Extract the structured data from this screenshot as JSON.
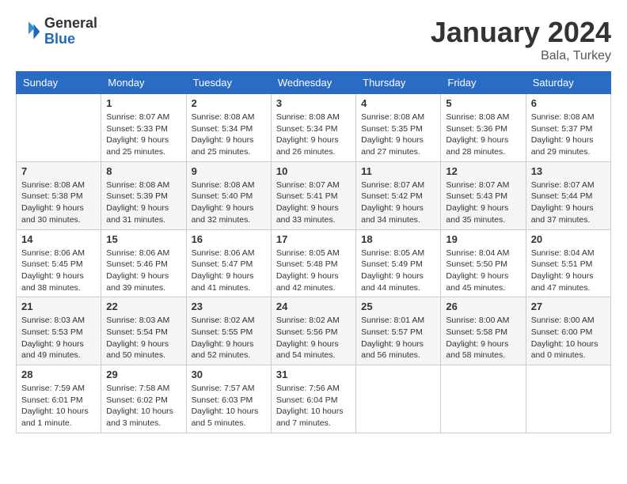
{
  "logo": {
    "general": "General",
    "blue": "Blue"
  },
  "header": {
    "title": "January 2024",
    "location": "Bala, Turkey"
  },
  "columns": [
    "Sunday",
    "Monday",
    "Tuesday",
    "Wednesday",
    "Thursday",
    "Friday",
    "Saturday"
  ],
  "weeks": [
    [
      {
        "day": "",
        "info": ""
      },
      {
        "day": "1",
        "info": "Sunrise: 8:07 AM\nSunset: 5:33 PM\nDaylight: 9 hours\nand 25 minutes."
      },
      {
        "day": "2",
        "info": "Sunrise: 8:08 AM\nSunset: 5:34 PM\nDaylight: 9 hours\nand 25 minutes."
      },
      {
        "day": "3",
        "info": "Sunrise: 8:08 AM\nSunset: 5:34 PM\nDaylight: 9 hours\nand 26 minutes."
      },
      {
        "day": "4",
        "info": "Sunrise: 8:08 AM\nSunset: 5:35 PM\nDaylight: 9 hours\nand 27 minutes."
      },
      {
        "day": "5",
        "info": "Sunrise: 8:08 AM\nSunset: 5:36 PM\nDaylight: 9 hours\nand 28 minutes."
      },
      {
        "day": "6",
        "info": "Sunrise: 8:08 AM\nSunset: 5:37 PM\nDaylight: 9 hours\nand 29 minutes."
      }
    ],
    [
      {
        "day": "7",
        "info": "Sunrise: 8:08 AM\nSunset: 5:38 PM\nDaylight: 9 hours\nand 30 minutes."
      },
      {
        "day": "8",
        "info": "Sunrise: 8:08 AM\nSunset: 5:39 PM\nDaylight: 9 hours\nand 31 minutes."
      },
      {
        "day": "9",
        "info": "Sunrise: 8:08 AM\nSunset: 5:40 PM\nDaylight: 9 hours\nand 32 minutes."
      },
      {
        "day": "10",
        "info": "Sunrise: 8:07 AM\nSunset: 5:41 PM\nDaylight: 9 hours\nand 33 minutes."
      },
      {
        "day": "11",
        "info": "Sunrise: 8:07 AM\nSunset: 5:42 PM\nDaylight: 9 hours\nand 34 minutes."
      },
      {
        "day": "12",
        "info": "Sunrise: 8:07 AM\nSunset: 5:43 PM\nDaylight: 9 hours\nand 35 minutes."
      },
      {
        "day": "13",
        "info": "Sunrise: 8:07 AM\nSunset: 5:44 PM\nDaylight: 9 hours\nand 37 minutes."
      }
    ],
    [
      {
        "day": "14",
        "info": "Sunrise: 8:06 AM\nSunset: 5:45 PM\nDaylight: 9 hours\nand 38 minutes."
      },
      {
        "day": "15",
        "info": "Sunrise: 8:06 AM\nSunset: 5:46 PM\nDaylight: 9 hours\nand 39 minutes."
      },
      {
        "day": "16",
        "info": "Sunrise: 8:06 AM\nSunset: 5:47 PM\nDaylight: 9 hours\nand 41 minutes."
      },
      {
        "day": "17",
        "info": "Sunrise: 8:05 AM\nSunset: 5:48 PM\nDaylight: 9 hours\nand 42 minutes."
      },
      {
        "day": "18",
        "info": "Sunrise: 8:05 AM\nSunset: 5:49 PM\nDaylight: 9 hours\nand 44 minutes."
      },
      {
        "day": "19",
        "info": "Sunrise: 8:04 AM\nSunset: 5:50 PM\nDaylight: 9 hours\nand 45 minutes."
      },
      {
        "day": "20",
        "info": "Sunrise: 8:04 AM\nSunset: 5:51 PM\nDaylight: 9 hours\nand 47 minutes."
      }
    ],
    [
      {
        "day": "21",
        "info": "Sunrise: 8:03 AM\nSunset: 5:53 PM\nDaylight: 9 hours\nand 49 minutes."
      },
      {
        "day": "22",
        "info": "Sunrise: 8:03 AM\nSunset: 5:54 PM\nDaylight: 9 hours\nand 50 minutes."
      },
      {
        "day": "23",
        "info": "Sunrise: 8:02 AM\nSunset: 5:55 PM\nDaylight: 9 hours\nand 52 minutes."
      },
      {
        "day": "24",
        "info": "Sunrise: 8:02 AM\nSunset: 5:56 PM\nDaylight: 9 hours\nand 54 minutes."
      },
      {
        "day": "25",
        "info": "Sunrise: 8:01 AM\nSunset: 5:57 PM\nDaylight: 9 hours\nand 56 minutes."
      },
      {
        "day": "26",
        "info": "Sunrise: 8:00 AM\nSunset: 5:58 PM\nDaylight: 9 hours\nand 58 minutes."
      },
      {
        "day": "27",
        "info": "Sunrise: 8:00 AM\nSunset: 6:00 PM\nDaylight: 10 hours\nand 0 minutes."
      }
    ],
    [
      {
        "day": "28",
        "info": "Sunrise: 7:59 AM\nSunset: 6:01 PM\nDaylight: 10 hours\nand 1 minute."
      },
      {
        "day": "29",
        "info": "Sunrise: 7:58 AM\nSunset: 6:02 PM\nDaylight: 10 hours\nand 3 minutes."
      },
      {
        "day": "30",
        "info": "Sunrise: 7:57 AM\nSunset: 6:03 PM\nDaylight: 10 hours\nand 5 minutes."
      },
      {
        "day": "31",
        "info": "Sunrise: 7:56 AM\nSunset: 6:04 PM\nDaylight: 10 hours\nand 7 minutes."
      },
      {
        "day": "",
        "info": ""
      },
      {
        "day": "",
        "info": ""
      },
      {
        "day": "",
        "info": ""
      }
    ]
  ]
}
